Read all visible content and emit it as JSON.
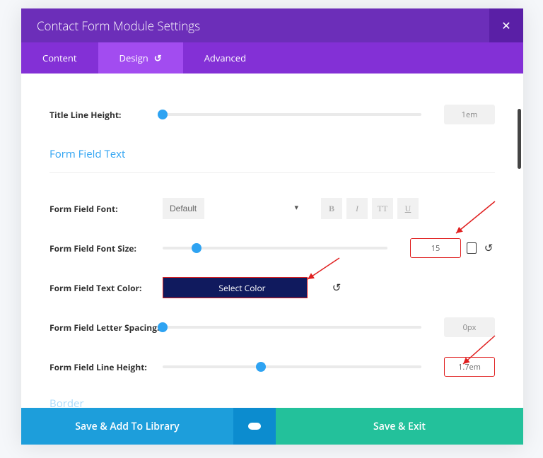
{
  "header": {
    "title": "Contact Form Module Settings",
    "close_glyph": "✕"
  },
  "tabs": {
    "content": "Content",
    "design": "Design",
    "advanced": "Advanced",
    "reset_glyph": "↺"
  },
  "section": {
    "form_field_text": "Form Field Text",
    "border": "Border"
  },
  "rows": {
    "title_line_height": {
      "label": "Title Line Height:",
      "value": "1em",
      "pos": 0
    },
    "font": {
      "label": "Form Field Font:",
      "select": "Default",
      "bold": "B",
      "italic": "I",
      "tt": "TT",
      "ul": "U"
    },
    "font_size": {
      "label": "Form Field Font Size:",
      "value": "15",
      "pos": 15
    },
    "text_color": {
      "label": "Form Field Text Color:",
      "select_color": "Select Color",
      "swatch": "#101a5e",
      "reset_glyph": "↺"
    },
    "letter_spacing": {
      "label": "Form Field Letter Spacing:",
      "value": "0px",
      "pos": 0
    },
    "line_height": {
      "label": "Form Field Line Height:",
      "value": "1.7em",
      "pos": 38
    }
  },
  "footer": {
    "save_lib": "Save & Add To Library",
    "save_exit": "Save & Exit"
  },
  "icons": {
    "reset": "↺",
    "device": "▭"
  }
}
